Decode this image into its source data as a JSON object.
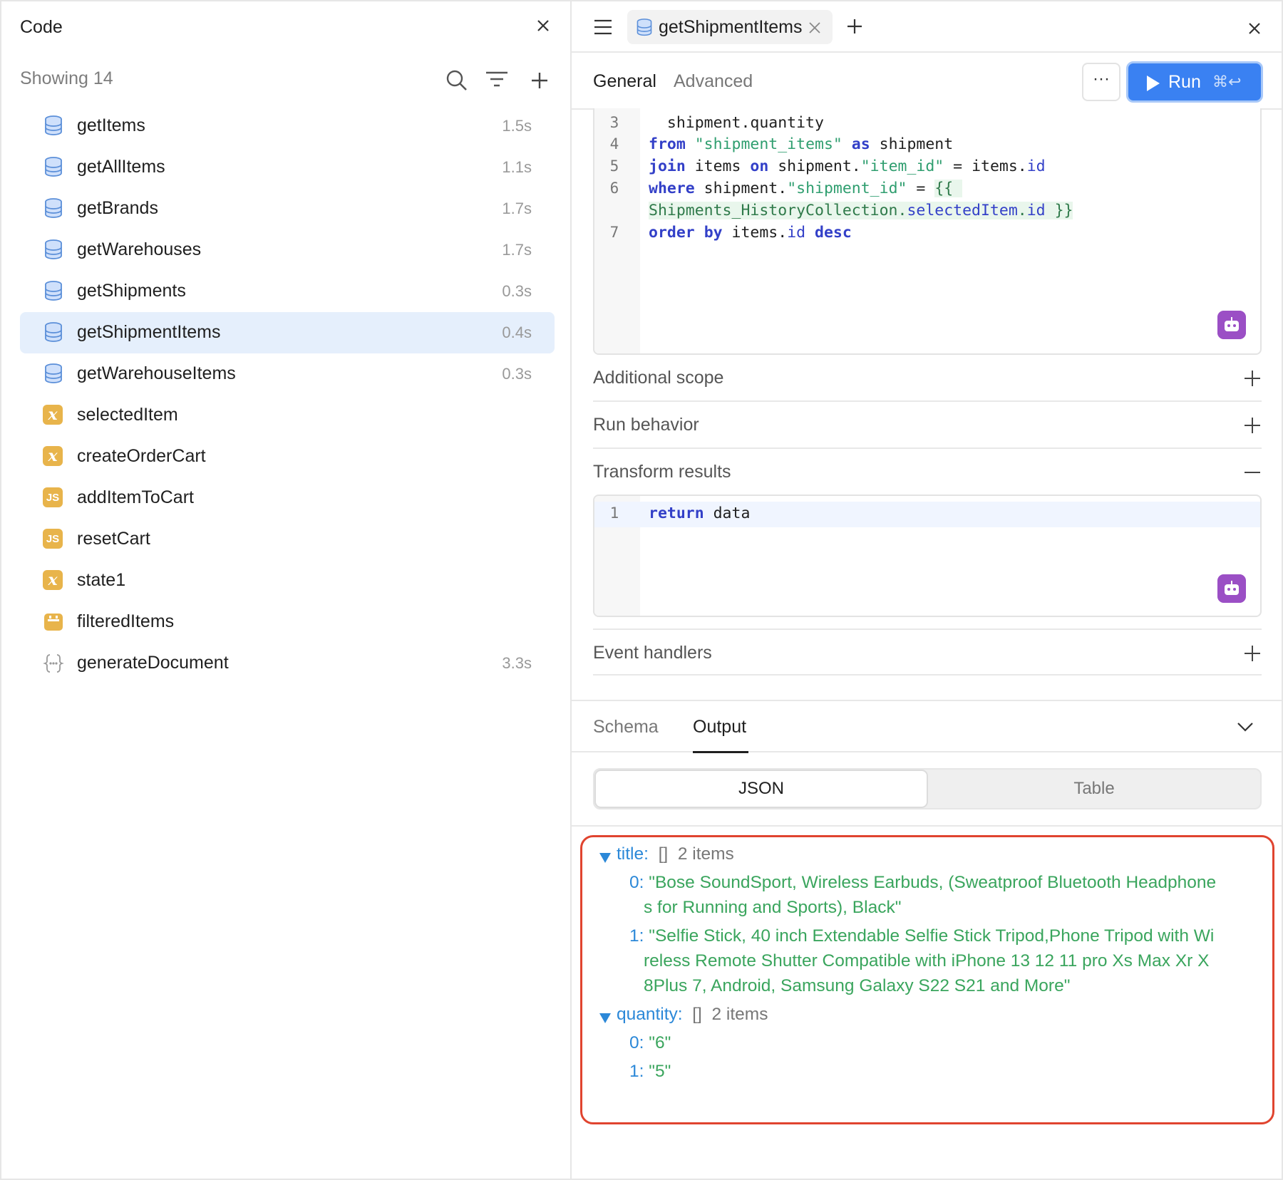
{
  "left_panel": {
    "title": "Code",
    "showing": "Showing 14",
    "items": [
      {
        "name": "getItems",
        "time": "1.5s",
        "icon": "database-icon"
      },
      {
        "name": "getAllItems",
        "time": "1.1s",
        "icon": "database-icon"
      },
      {
        "name": "getBrands",
        "time": "1.7s",
        "icon": "database-icon"
      },
      {
        "name": "getWarehouses",
        "time": "1.7s",
        "icon": "database-icon"
      },
      {
        "name": "getShipments",
        "time": "0.3s",
        "icon": "database-icon"
      },
      {
        "name": "getShipmentItems",
        "time": "0.4s",
        "icon": "database-icon",
        "selected": true
      },
      {
        "name": "getWarehouseItems",
        "time": "0.3s",
        "icon": "database-icon"
      },
      {
        "name": "selectedItem",
        "time": "",
        "icon": "variable-icon"
      },
      {
        "name": "createOrderCart",
        "time": "",
        "icon": "variable-icon"
      },
      {
        "name": "addItemToCart",
        "time": "",
        "icon": "javascript-icon"
      },
      {
        "name": "resetCart",
        "time": "",
        "icon": "javascript-icon"
      },
      {
        "name": "state1",
        "time": "",
        "icon": "variable-icon"
      },
      {
        "name": "filteredItems",
        "time": "",
        "icon": "transformer-icon"
      },
      {
        "name": "generateDocument",
        "time": "3.3s",
        "icon": "workflow-icon"
      }
    ]
  },
  "right_panel": {
    "tab_name": "getShipmentItems",
    "subtabs": {
      "general": "General",
      "advanced": "Advanced"
    },
    "more_label": "···",
    "run": {
      "label": "Run",
      "shortcut": "⌘↩"
    },
    "query_lines": [
      {
        "n": "3",
        "text": "  shipment.quantity"
      },
      {
        "n": "4",
        "text": "from \"shipment_items\" as shipment"
      },
      {
        "n": "5",
        "text": "join items on shipment.\"item_id\" = items.id"
      },
      {
        "n": "6",
        "text": "where shipment.\"shipment_id\" = {{ Shipments_HistoryCollection.selectedItem.id }}"
      },
      {
        "n": "7",
        "text": "order by items.id desc"
      }
    ],
    "sections": {
      "additional_scope": "Additional scope",
      "run_behavior": "Run behavior",
      "transform_results": "Transform results",
      "event_handlers": "Event handlers"
    },
    "transform_code": {
      "n": "1",
      "keyword": "return",
      "rest": " data"
    },
    "output_tabs": {
      "schema": "Schema",
      "output": "Output"
    },
    "view_toggle": {
      "json": "JSON",
      "table": "Table"
    },
    "json_output": {
      "title_key": "title:",
      "title_meta": "2 items",
      "title_items": [
        {
          "idx": "0:",
          "line1": "\"Bose SoundSport, Wireless Earbuds, (Sweatproof Bluetooth Headphone",
          "line2": "s for Running and Sports), Black\""
        },
        {
          "idx": "1:",
          "line1": "\"Selfie Stick, 40 inch Extendable Selfie Stick Tripod,Phone Tripod with Wi",
          "line2": "reless Remote Shutter Compatible with iPhone 13 12 11 pro Xs Max Xr X",
          "line3": "8Plus 7, Android, Samsung Galaxy S22 S21 and More\""
        }
      ],
      "quantity_key": "quantity:",
      "quantity_meta": "2 items",
      "quantity_items": [
        {
          "idx": "0:",
          "value": "\"6\""
        },
        {
          "idx": "1:",
          "value": "\"5\""
        }
      ],
      "bracket": "[]"
    }
  },
  "colors": {
    "accent": "#3a81f2",
    "selected_row": "#e5effc",
    "highlight_border": "#e0442f",
    "json_string": "#3aa55d",
    "json_key": "#2b88d8"
  }
}
